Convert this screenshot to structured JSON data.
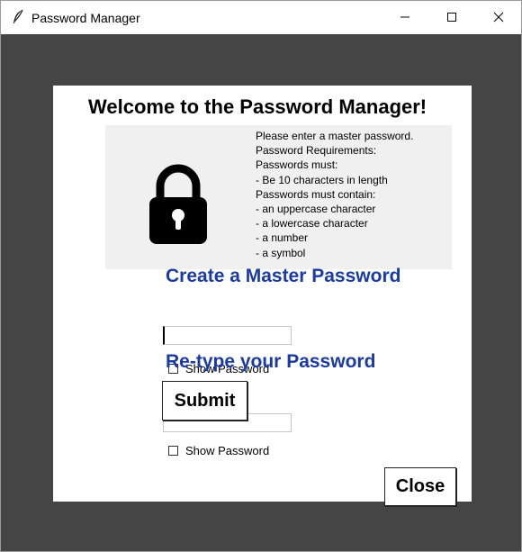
{
  "window": {
    "title": "Password Manager",
    "icon": "feather-icon",
    "controls": [
      "minimize-icon",
      "maximize-icon",
      "close-icon"
    ]
  },
  "dialog": {
    "welcome": "Welcome to the Password Manager!",
    "requirements": [
      "Please enter a master password.",
      "Password Requirements:",
      "Passwords must:",
      "- Be 10 characters in length",
      "Passwords must contain:",
      "- an uppercase character",
      "- a lowercase character",
      "- a number",
      "- a symbol"
    ],
    "lock_icon": "padlock-icon",
    "create_heading": "Create a Master Password",
    "create_value": "",
    "show_password_1": "Show Password",
    "retype_heading": "Re-type your Password",
    "retype_value": "",
    "show_password_2": "Show Password",
    "submit_label": "Submit",
    "close_label": "Close"
  },
  "colors": {
    "heading_blue": "#1a3aa6",
    "background_dark": "#454545"
  }
}
